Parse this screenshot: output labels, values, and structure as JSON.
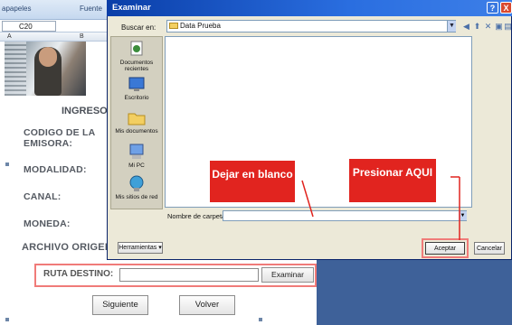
{
  "sheet": {
    "ribbon": {
      "item1": "apapeles",
      "item2": "Fuente"
    },
    "namebox": "C20",
    "columns": [
      "A",
      "B"
    ],
    "form": {
      "heading": "INGRESO",
      "codigo_line1": "CODIGO DE LA",
      "codigo_line2": "EMISORA:",
      "modalidad": "MODALIDAD:",
      "canal": "CANAL:",
      "moneda": "MONEDA:",
      "archivo": "ARCHIVO ORIGEN:",
      "ruta": "RUTA DESTINO:",
      "examinar": "Examinar",
      "siguiente": "Siguiente",
      "volver": "Volver"
    }
  },
  "dialog": {
    "title": "Examinar",
    "help": "?",
    "close": "X",
    "buscar_label": "Buscar en:",
    "buscar_value": "Data Prueba",
    "places": [
      {
        "icon": "recent-documents-icon",
        "label": "Documentos recientes"
      },
      {
        "icon": "desktop-icon",
        "label": "Escritorio"
      },
      {
        "icon": "my-documents-icon",
        "label": "Mis documentos"
      },
      {
        "icon": "my-computer-icon",
        "label": "Mi PC"
      },
      {
        "icon": "network-places-icon",
        "label": "Mis sitios de red"
      }
    ],
    "carpeta_label": "Nombre de carpeta:",
    "carpeta_value": "",
    "herramientas": "Herramientas",
    "aceptar": "Aceptar",
    "cancelar": "Cancelar"
  },
  "annotations": {
    "blanco": "Dejar en blanco",
    "aqui": "Presionar AQUI",
    "color": "#e1241f",
    "highlight_color": "#f07b79"
  }
}
